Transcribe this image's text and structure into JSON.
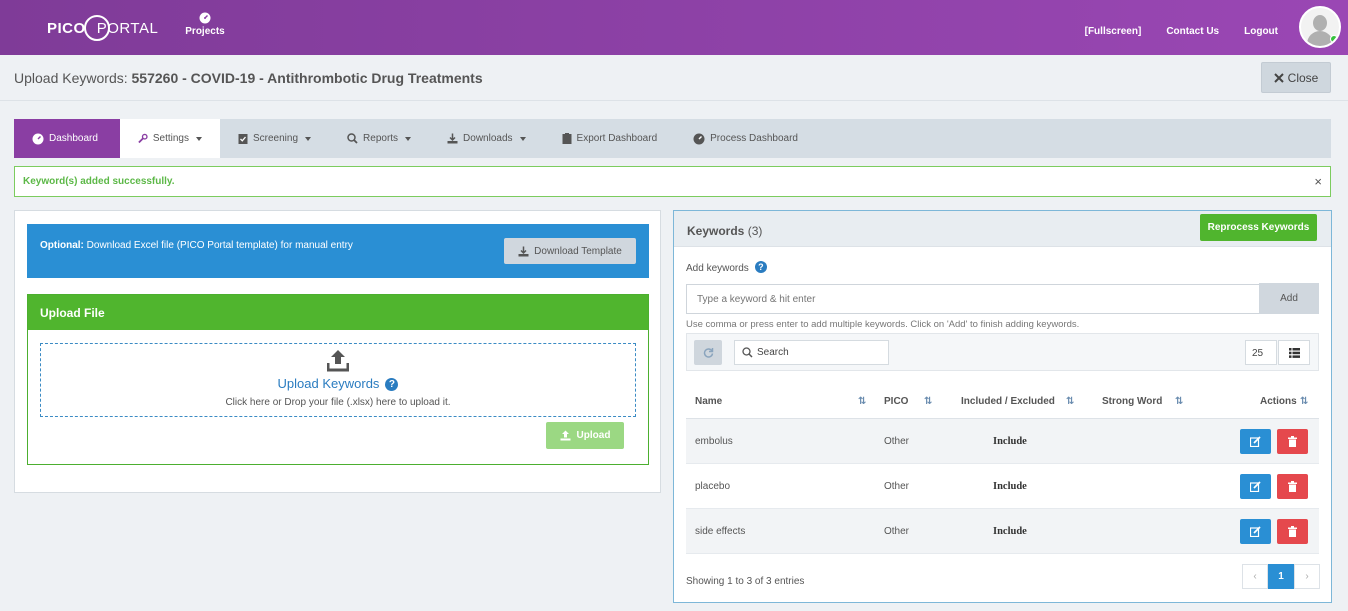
{
  "topbar": {
    "logo_left": "PICO",
    "logo_right": "PORTAL",
    "projects_label": "Projects",
    "fullscreen_label": "Fullscreen",
    "contact_label": "Contact Us",
    "logout_label": "Logout"
  },
  "header": {
    "title_prefix": "Upload Keywords:",
    "title": "557260 - COVID-19 - Antithrombotic Drug Treatments",
    "close_label": "Close"
  },
  "nav": {
    "items": [
      {
        "label": "Dashboard",
        "icon": "dashboard-icon"
      },
      {
        "label": "Settings",
        "icon": "wrench-icon"
      },
      {
        "label": "Screening",
        "icon": "clipboard-check-icon"
      },
      {
        "label": "Reports",
        "icon": "search-icon"
      },
      {
        "label": "Downloads",
        "icon": "download-icon"
      },
      {
        "label": "Export Dashboard",
        "icon": "clipboard-icon"
      },
      {
        "label": "Process Dashboard",
        "icon": "gauge-icon"
      }
    ]
  },
  "alert": {
    "message": "Keyword(s) added successfully.",
    "close": "×"
  },
  "left": {
    "optional_bold": "Optional:",
    "optional_text": "Download Excel file (PICO Portal template) for manual entry",
    "download_template_label": "Download Template",
    "upload_file_title": "Upload File",
    "dropzone_title": "Upload Keywords",
    "dropzone_sub": "Click here or Drop your file (.xlsx) here to upload it.",
    "upload_button_label": "Upload",
    "help": "?"
  },
  "keywords": {
    "title": "Keywords",
    "count": "(3)",
    "reprocess_label": "Reprocess Keywords",
    "add_label": "Add keywords",
    "input_placeholder": "Type a keyword & hit enter",
    "add_button_label": "Add",
    "helper_text": "Use comma or press enter to add multiple keywords. Click on 'Add' to finish adding keywords.",
    "search_placeholder": "Search",
    "page_size": "25",
    "columns": [
      "Name",
      "PICO",
      "Included / Excluded",
      "Strong Word",
      "Actions"
    ],
    "rows": [
      {
        "name": "embolus",
        "pico": "Other",
        "status": "Include",
        "strong": ""
      },
      {
        "name": "placebo",
        "pico": "Other",
        "status": "Include",
        "strong": ""
      },
      {
        "name": "side effects",
        "pico": "Other",
        "status": "Include",
        "strong": ""
      }
    ],
    "showing": "Showing 1 to 3 of 3 entries",
    "pager": {
      "prev": "‹",
      "current": "1",
      "next": "›"
    }
  },
  "colors": {
    "brand_purple": "#8a3ea3",
    "success_green": "#50b52e",
    "info_blue": "#2a8fd4",
    "danger_red": "#e5484d"
  }
}
